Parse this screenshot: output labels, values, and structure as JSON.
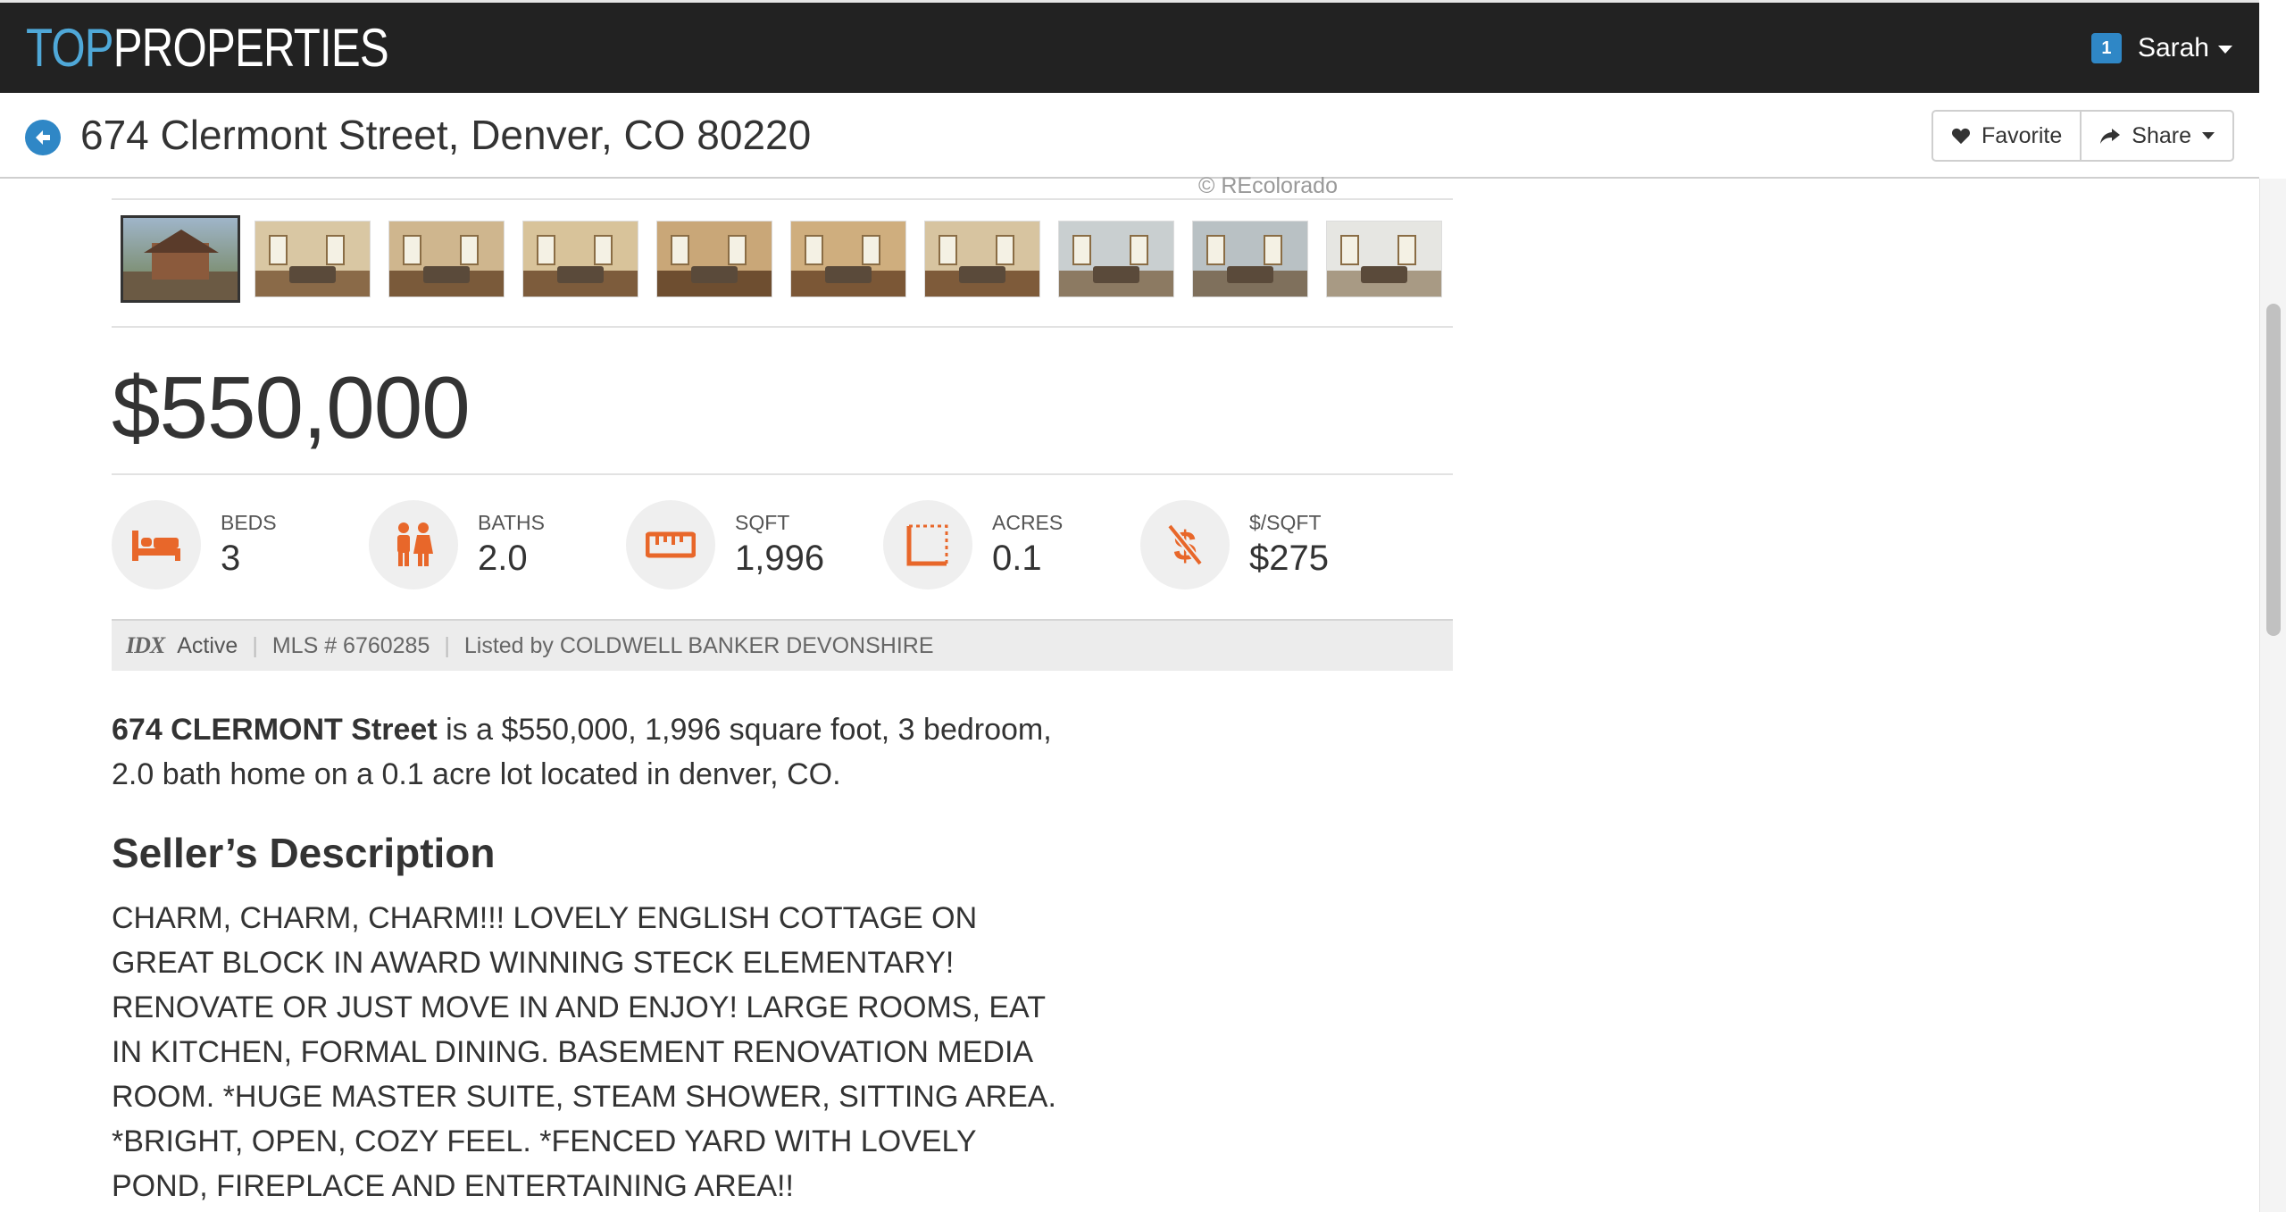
{
  "brand": {
    "top": "TOP",
    "rest": "PROPERTIES"
  },
  "user": {
    "notification_count": "1",
    "name": "Sarah"
  },
  "listing": {
    "address": "674 Clermont Street, Denver, CO 80220",
    "favorite_label": "Favorite",
    "share_label": "Share",
    "photo_credit": "© REcolorado",
    "price": "$550,000",
    "thumbnail_count": 10,
    "stats": {
      "beds": {
        "label": "BEDS",
        "value": "3"
      },
      "baths": {
        "label": "BATHS",
        "value": "2.0"
      },
      "sqft": {
        "label": "SQFT",
        "value": "1,996"
      },
      "acres": {
        "label": "ACRES",
        "value": "0.1"
      },
      "price_per_sqft": {
        "label": "$/SQFT",
        "value": "$275"
      }
    },
    "status": {
      "idx_logo": "IDX",
      "state": "Active",
      "mls": "MLS # 6760285",
      "listed_by": "Listed by COLDWELL BANKER DEVONSHIRE"
    },
    "summary_bold": "674 CLERMONT Street",
    "summary_rest": " is a $550,000, 1,996 square foot, 3 bedroom, 2.0 bath home on a 0.1 acre lot located in denver, CO.",
    "description_title": "Seller’s Description",
    "description": "CHARM, CHARM, CHARM!!! LOVELY ENGLISH COTTAGE ON GREAT BLOCK IN AWARD WINNING STECK ELEMENTARY! RENOVATE OR JUST MOVE IN AND ENJOY! LARGE ROOMS, EAT IN KITCHEN, FORMAL DINING. BASEMENT RENOVATION MEDIA ROOM. *HUGE MASTER SUITE, STEAM SHOWER, SITTING AREA. *BRIGHT, OPEN, COZY FEEL. *FENCED YARD WITH LOVELY POND, FIREPLACE AND ENTERTAINING AREA!!"
  },
  "colors": {
    "accent_orange": "#e8672a",
    "brand_blue": "#4fa8d8",
    "nav_bg": "#222222"
  }
}
